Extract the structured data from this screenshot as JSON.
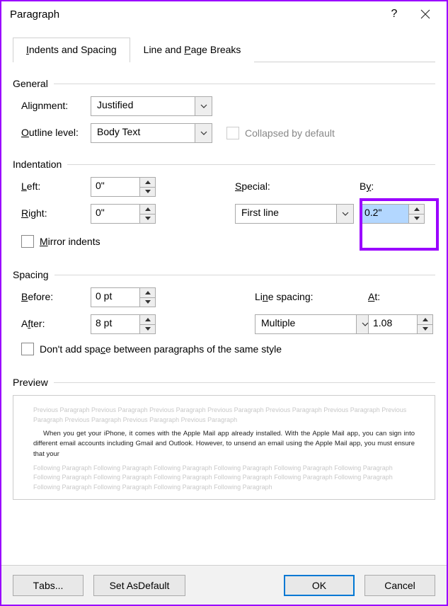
{
  "title": "Paragraph",
  "tabs": {
    "indents": "Indents and Spacing",
    "linepage": "Line and Page Breaks"
  },
  "general": {
    "header": "General",
    "alignment_label": "Alignment:",
    "alignment_value": "Justified",
    "outline_label": "Outline level:",
    "outline_value": "Body Text",
    "collapsed_label": "Collapsed by default"
  },
  "indentation": {
    "header": "Indentation",
    "left_label": "Left:",
    "left_value": "0\"",
    "right_label": "Right:",
    "right_value": "0\"",
    "special_label": "Special:",
    "special_value": "First line",
    "by_label": "By:",
    "by_value": "0.2\"",
    "mirror_label": "Mirror indents"
  },
  "spacing": {
    "header": "Spacing",
    "before_label": "Before:",
    "before_value": "0 pt",
    "after_label": "After:",
    "after_value": "8 pt",
    "linespacing_label": "Line spacing:",
    "linespacing_value": "Multiple",
    "at_label": "At:",
    "at_value": "1.08",
    "dontadd_label": "Don't add space between paragraphs of the same style"
  },
  "preview": {
    "header": "Preview",
    "previous": "Previous Paragraph Previous Paragraph Previous Paragraph Previous Paragraph Previous Paragraph Previous Paragraph Previous Paragraph Previous Paragraph Previous Paragraph Previous Paragraph",
    "body": "When you get your iPhone, it comes with the Apple Mail app already installed. With the Apple Mail app, you can sign into different email accounts including Gmail and Outlook. However, to unsend an email using the Apple Mail app, you must ensure that your",
    "following": "Following Paragraph Following Paragraph Following Paragraph Following Paragraph Following Paragraph Following Paragraph Following Paragraph Following Paragraph Following Paragraph Following Paragraph Following Paragraph Following Paragraph Following Paragraph Following Paragraph Following Paragraph Following Paragraph"
  },
  "footer": {
    "tabs": "Tabs...",
    "setdefault": "Set As Default",
    "ok": "OK",
    "cancel": "Cancel"
  }
}
